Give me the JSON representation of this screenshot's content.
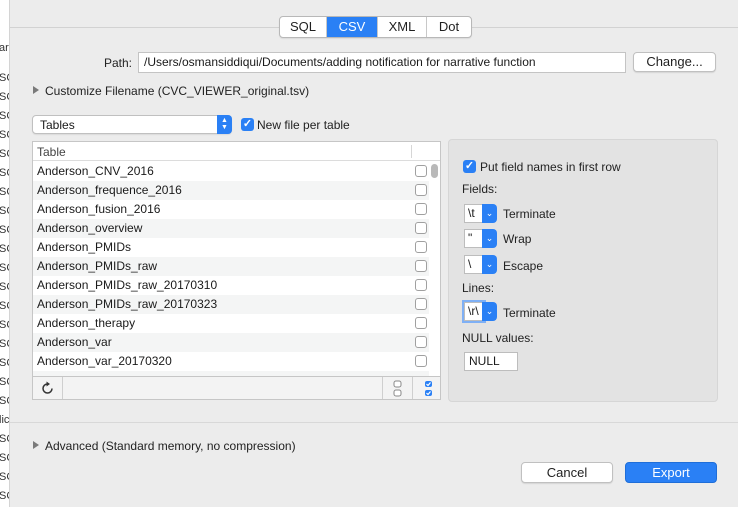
{
  "format_tabs": [
    "SQL",
    "CSV",
    "XML",
    "Dot"
  ],
  "active_tab": "CSV",
  "path": {
    "label": "Path:",
    "value": "/Users/osmansiddiqui/Documents/adding notification for narrative function",
    "change_button": "Change..."
  },
  "customize_filename": "Customize Filename (CVC_VIEWER_original.tsv)",
  "tables_popup": "Tables",
  "new_file_per_table": "New file per table",
  "table": {
    "header": "Table",
    "rows": [
      "Anderson_CNV_2016",
      "Anderson_frequence_2016",
      "Anderson_fusion_2016",
      "Anderson_overview",
      "Anderson_PMIDs",
      "Anderson_PMIDs_raw",
      "Anderson_PMIDs_raw_20170310",
      "Anderson_PMIDs_raw_20170323",
      "Anderson_therapy",
      "Anderson_var",
      "Anderson_var_20170320"
    ]
  },
  "options": {
    "put_field_names": "Put field names in first row",
    "fields_label": "Fields:",
    "terminate_value": "\\t",
    "terminate_label": "Terminate",
    "wrap_value": "\"",
    "wrap_label": "Wrap",
    "escape_value": "\\",
    "escape_label": "Escape",
    "lines_label": "Lines:",
    "lines_value": "\\r\\",
    "lines_terminate_label": "Terminate",
    "null_label": "NULL values:",
    "null_value": "NULL"
  },
  "advanced": "Advanced (Standard memory, no compression)",
  "cancel_button": "Cancel",
  "export_button": "Export",
  "colors": {
    "accent": "#2a80f5",
    "window_bg": "#ececec"
  },
  "icons": [
    "disclosure-triangle-icon",
    "popup-arrows-icon",
    "checkbox-icon",
    "refresh-icon",
    "dropdown-chevron-icon"
  ]
}
